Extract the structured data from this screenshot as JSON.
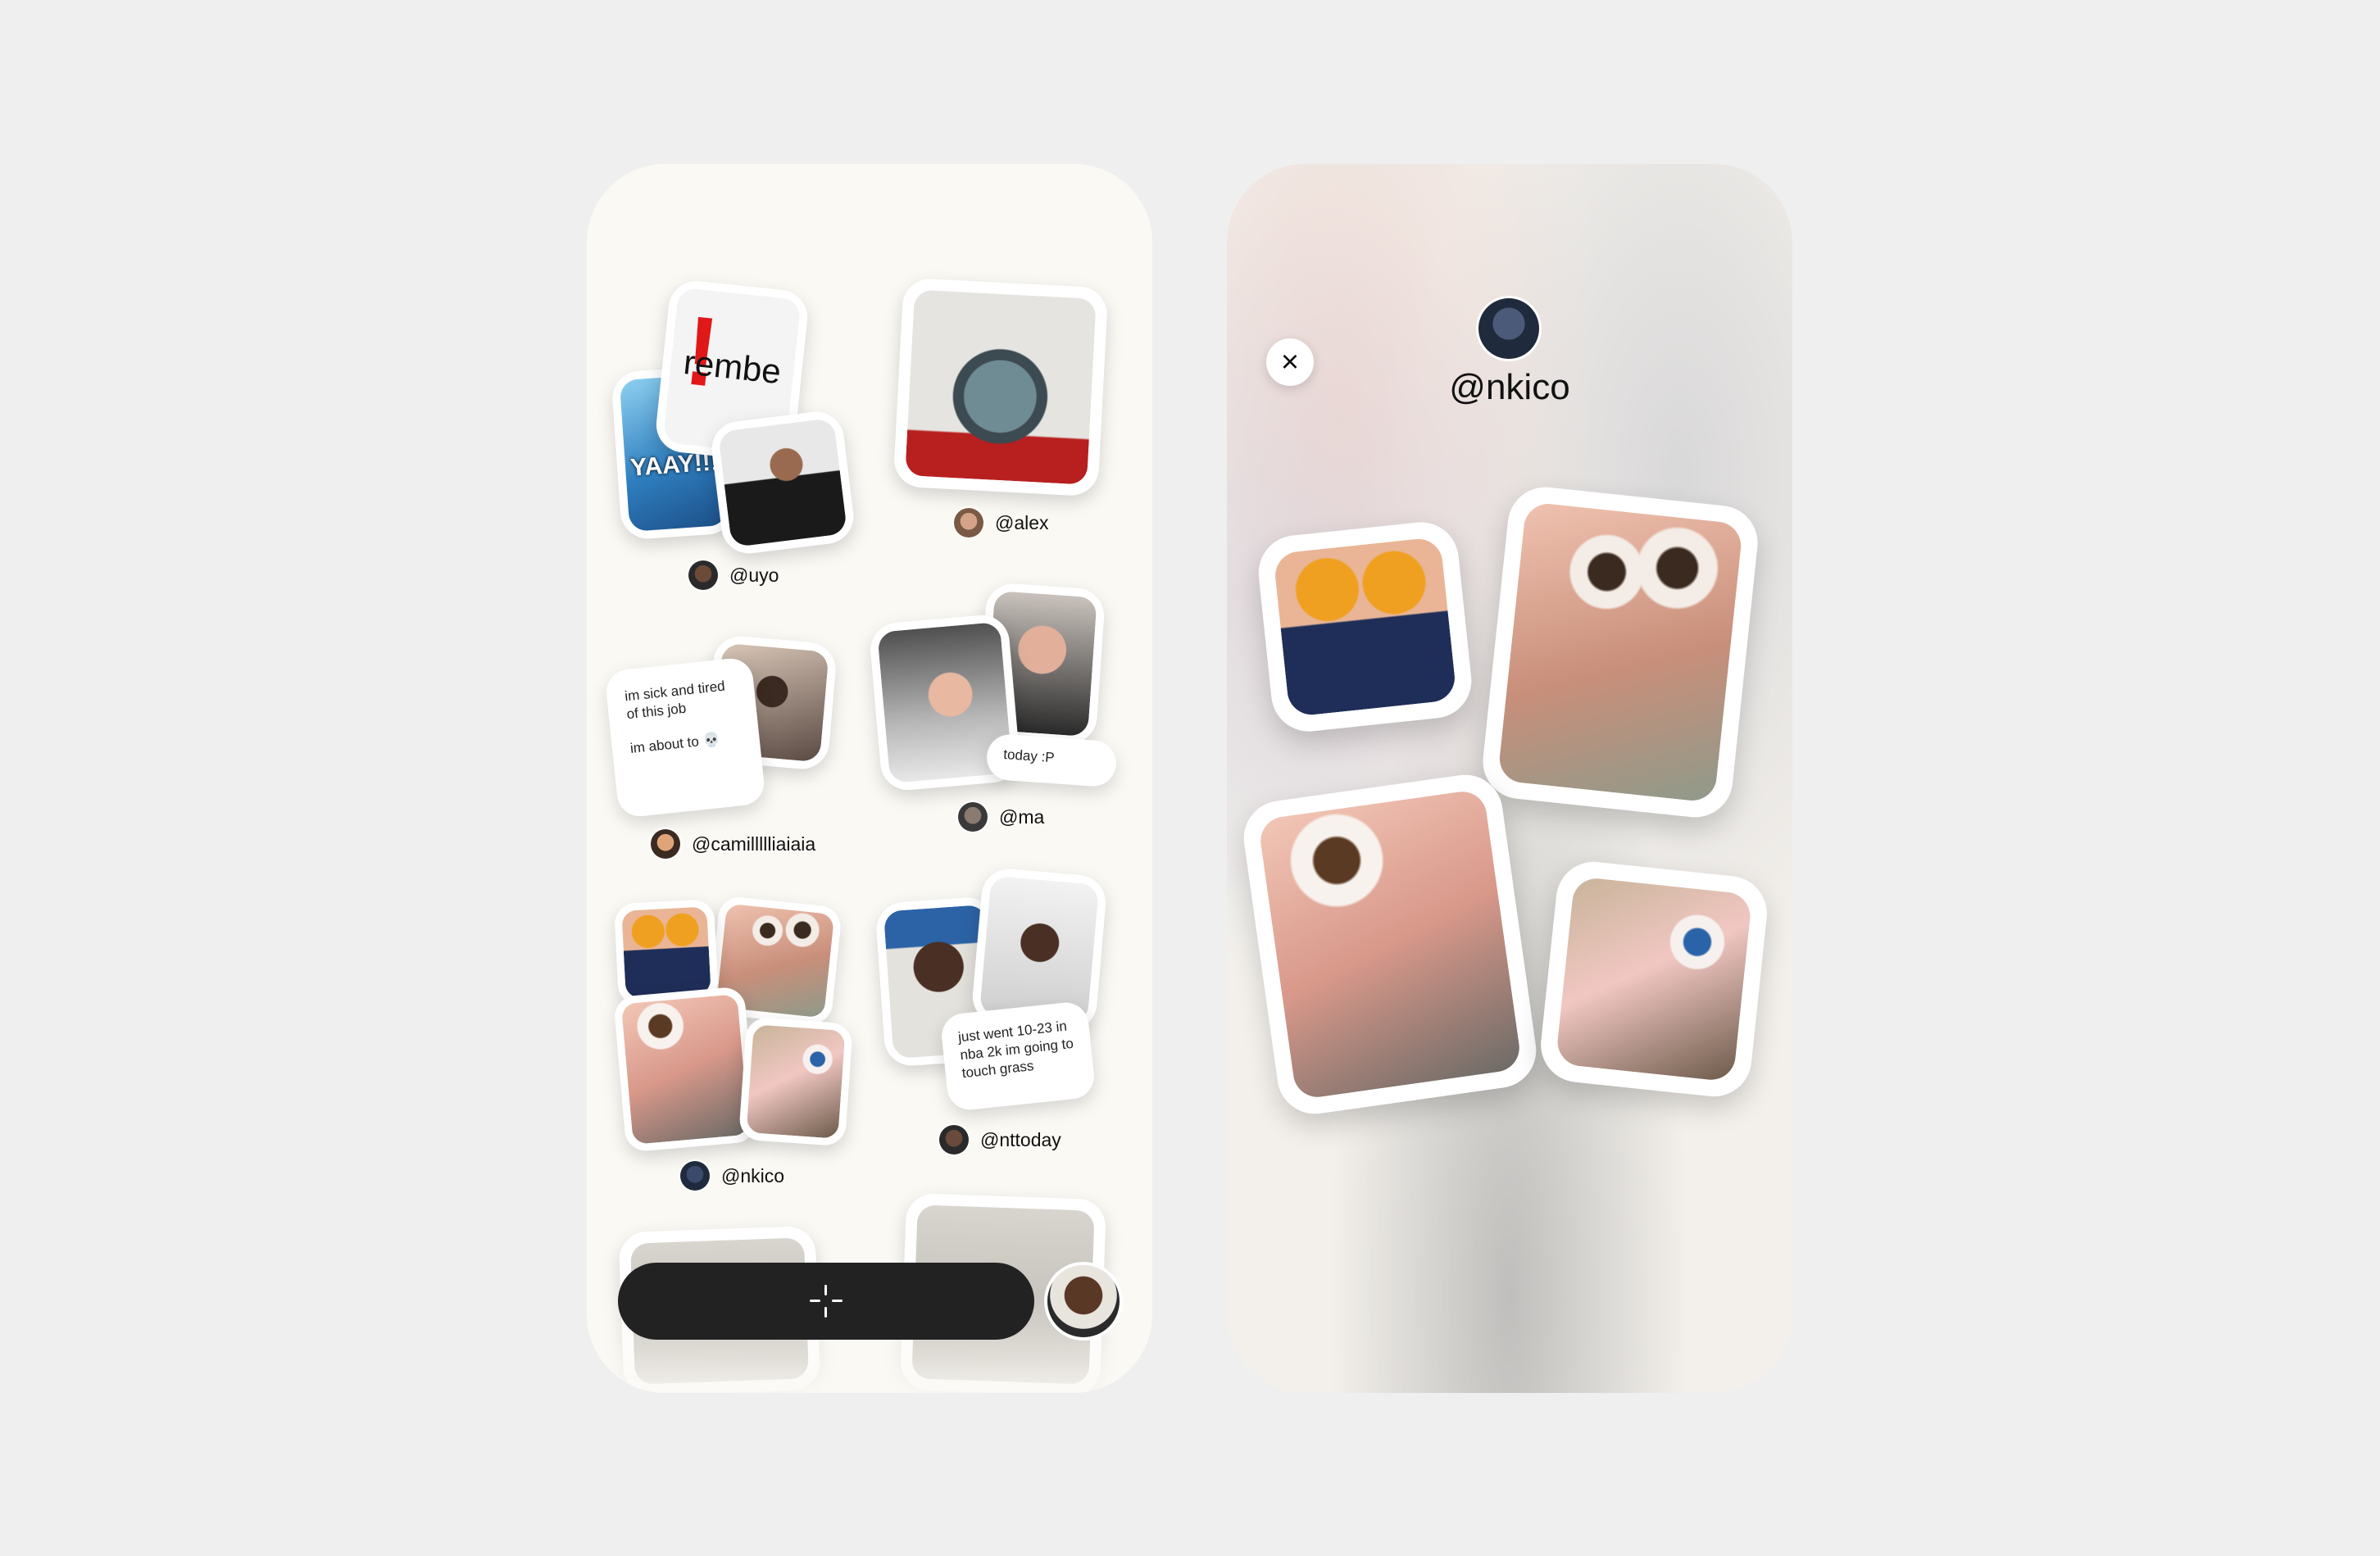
{
  "feed": {
    "users": {
      "uyo": "@uyo",
      "alex": "@alex",
      "camilla": "@camillllliaiaia",
      "ma": "@ma",
      "nkico": "@nkico",
      "nttoday": "@nttoday"
    },
    "sticker_texts": {
      "rembe": "rembe",
      "yaay": "YAAY!!!"
    },
    "notes": {
      "sick_line1": "im sick and tired of this job",
      "sick_line2": "im about to 💀",
      "today": "today :P",
      "nba": "just went 10-23 in nba 2k im going to touch grass"
    }
  },
  "detail": {
    "username": "@nkico",
    "close_icon": "×"
  },
  "icons": {
    "add": "sparkle-plus-icon",
    "close": "close-icon"
  },
  "colors": {
    "background": "#efefef",
    "phone": "#fbf9f4",
    "dock": "#222222"
  }
}
